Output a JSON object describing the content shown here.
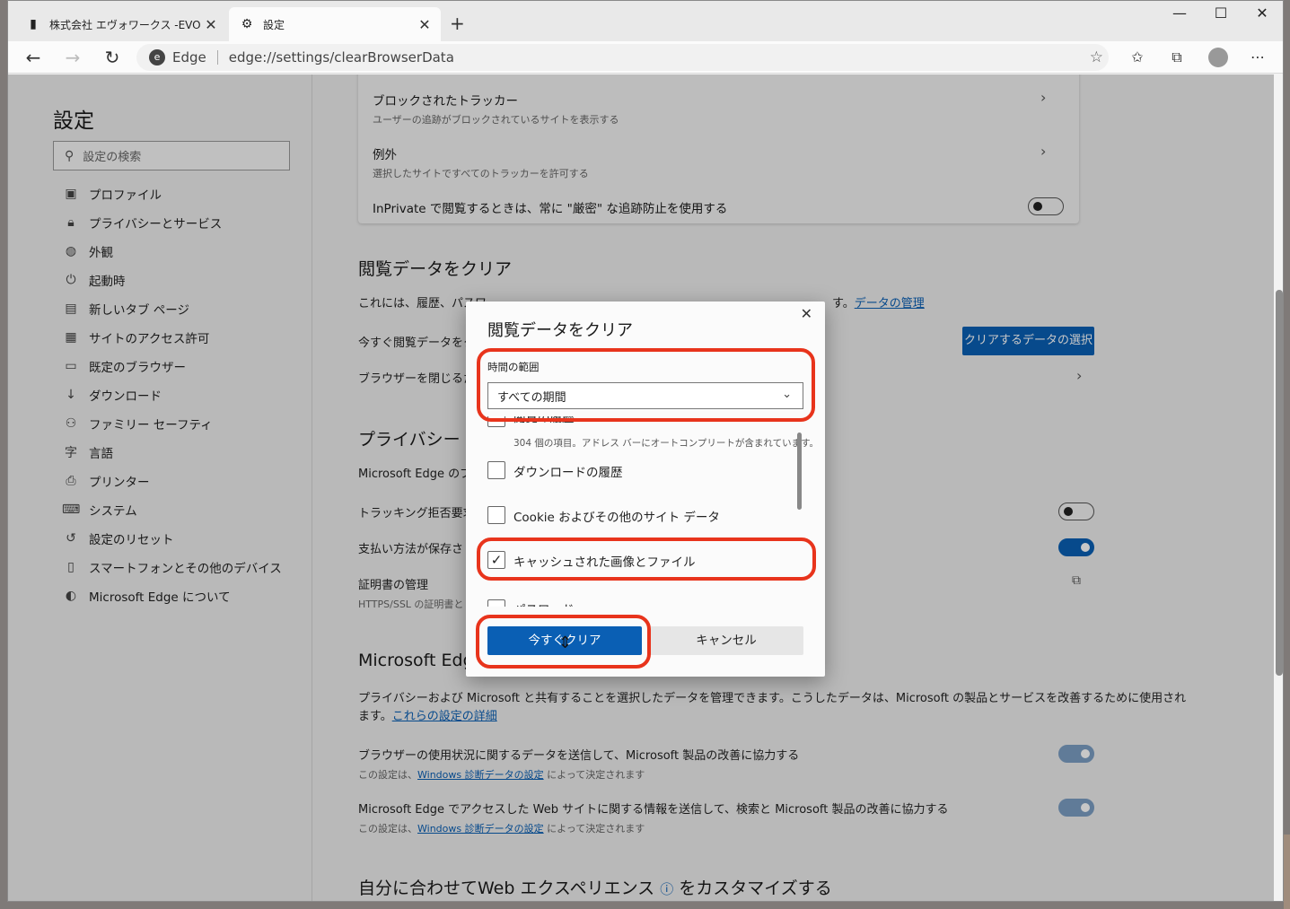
{
  "tabs": [
    {
      "title": "株式会社 エヴォワークス -EVOWORKS-",
      "active": false,
      "favicon": "notebook-icon"
    },
    {
      "title": "設定",
      "active": true,
      "favicon": "gear-icon"
    }
  ],
  "address": {
    "site_label": "Edge",
    "url": "edge://settings/clearBrowserData"
  },
  "sidebar": {
    "title": "設定",
    "search_placeholder": "設定の検索",
    "items": [
      {
        "label": "プロファイル",
        "icon": "profile-icon"
      },
      {
        "label": "プライバシーとサービス",
        "icon": "lock-icon"
      },
      {
        "label": "外観",
        "icon": "palette-icon"
      },
      {
        "label": "起動時",
        "icon": "power-icon"
      },
      {
        "label": "新しいタブ ページ",
        "icon": "newtab-icon"
      },
      {
        "label": "サイトのアクセス許可",
        "icon": "permissions-icon"
      },
      {
        "label": "既定のブラウザー",
        "icon": "browser-icon"
      },
      {
        "label": "ダウンロード",
        "icon": "download-icon"
      },
      {
        "label": "ファミリー セーフティ",
        "icon": "family-icon"
      },
      {
        "label": "言語",
        "icon": "language-icon"
      },
      {
        "label": "プリンター",
        "icon": "printer-icon"
      },
      {
        "label": "システム",
        "icon": "laptop-icon"
      },
      {
        "label": "設定のリセット",
        "icon": "reset-icon"
      },
      {
        "label": "スマートフォンとその他のデバイス",
        "icon": "phone-icon"
      },
      {
        "label": "Microsoft Edge について",
        "icon": "edge-icon"
      }
    ]
  },
  "tracking_card": {
    "blocked": {
      "title": "ブロックされたトラッカー",
      "sub": "ユーザーの追跡がブロックされているサイトを表示する"
    },
    "exceptions": {
      "title": "例外",
      "sub": "選択したサイトですべてのトラッカーを許可する"
    },
    "inprivate": {
      "title": "InPrivate で閲覧するときは、常に \"厳密\" な追跡防止を使用する",
      "toggle": false
    }
  },
  "clear_section": {
    "heading": "閲覧データをクリア",
    "desc_prefix": "これには、履歴、パスワ",
    "desc_suffix": "す。",
    "manage_link": "データの管理",
    "clear_now_label": "今すぐ閲覧データをクリ",
    "choose_button": "クリアするデータの選択",
    "on_close_label": "ブラウザーを閉じるたび"
  },
  "privacy_section": {
    "heading": "プライバシー",
    "desc": "Microsoft Edge のプ",
    "dnt_label": "トラッキング拒否要求",
    "dnt_toggle": false,
    "payment_label": "支払い方法が保存さ",
    "payment_toggle": true,
    "cert_title": "証明書の管理",
    "cert_sub": "HTTPS/SSL の証明書と"
  },
  "diag_section": {
    "heading": "Microsoft Edg",
    "desc_line1": "プライバシーおよび Microsoft と共有することを選択したデータを管理できます。こうしたデータは、Microsoft の製品とサービスを改善するために使用され",
    "desc_line2_prefix": "ます。",
    "details_link": "これらの設定の詳細",
    "row1_title": "ブラウザーの使用状況に関するデータを送信して、Microsoft 製品の改善に協力する",
    "row2_title": "Microsoft Edge でアクセスした Web サイトに関する情報を送信して、検索と Microsoft 製品の改善に協力する",
    "sub_prefix": "この設定は、",
    "sub_link": "Windows 診断データの設定",
    "sub_suffix": " によって決定されます"
  },
  "personalize_heading": "自分に合わせてWeb エクスペリエンス",
  "personalize_heading_suffix": "をカスタマイズする",
  "dialog": {
    "title": "閲覧データをクリア",
    "range_label": "時間の範囲",
    "range_value": "すべての期間",
    "options": [
      {
        "label": "閲覧の履歴",
        "sub": "304 個の項目。アドレス バーにオートコンプリートが含まれています。",
        "checked": false
      },
      {
        "label": "ダウンロードの履歴",
        "checked": false
      },
      {
        "label": "Cookie およびその他のサイト データ",
        "checked": false
      },
      {
        "label": "キャッシュされた画像とファイル",
        "checked": true
      },
      {
        "label": "パスワード",
        "checked": false
      }
    ],
    "clear_button": "今すぐクリア",
    "cancel_button": "キャンセル"
  },
  "colors": {
    "accent": "#0a5fb4",
    "highlight_ring": "#e8341c"
  }
}
